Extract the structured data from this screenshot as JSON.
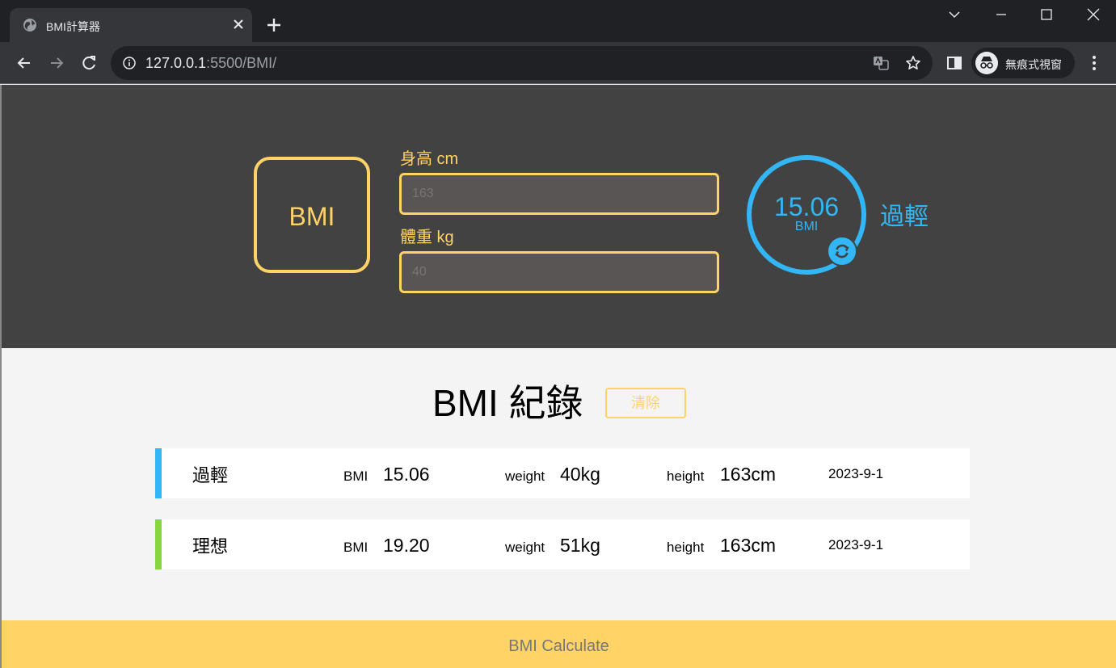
{
  "browser": {
    "tab_title": "BMI計算器",
    "url_host": "127.0.0.1",
    "url_rest": ":5500/BMI/",
    "incognito_label": "無痕式視窗"
  },
  "app": {
    "logo": "BMI",
    "height_label": "身高 cm",
    "height_value": "163",
    "weight_label": "體重 kg",
    "weight_value": "40",
    "result_value": "15.06",
    "result_unit": "BMI",
    "result_status": "過輕",
    "records_title": "BMI 紀錄",
    "clear_label": "清除",
    "footer_label": "BMI Calculate"
  },
  "records": [
    {
      "status": "過輕",
      "bmi_label": "BMI",
      "bmi": "15.06",
      "weight_label": "weight",
      "weight": "40kg",
      "height_label": "height",
      "height": "163cm",
      "date": "2023-9-1",
      "color": "#33b6f5"
    },
    {
      "status": "理想",
      "bmi_label": "BMI",
      "bmi": "19.20",
      "weight_label": "weight",
      "weight": "51kg",
      "height_label": "height",
      "height": "163cm",
      "date": "2023-9-1",
      "color": "#86d73f"
    }
  ],
  "colors": {
    "accent_yellow": "#ffd366",
    "accent_blue": "#33b6f5",
    "accent_green": "#86d73f",
    "header_bg": "#424242"
  },
  "icons": [
    "globe-icon",
    "close-icon",
    "plus-icon",
    "chevron-down-icon",
    "minimize-icon",
    "maximize-icon",
    "back-icon",
    "forward-icon",
    "reload-icon",
    "info-icon",
    "translate-icon",
    "star-icon",
    "sidepanel-icon",
    "incognito-icon",
    "more-icon",
    "refresh-icon"
  ]
}
